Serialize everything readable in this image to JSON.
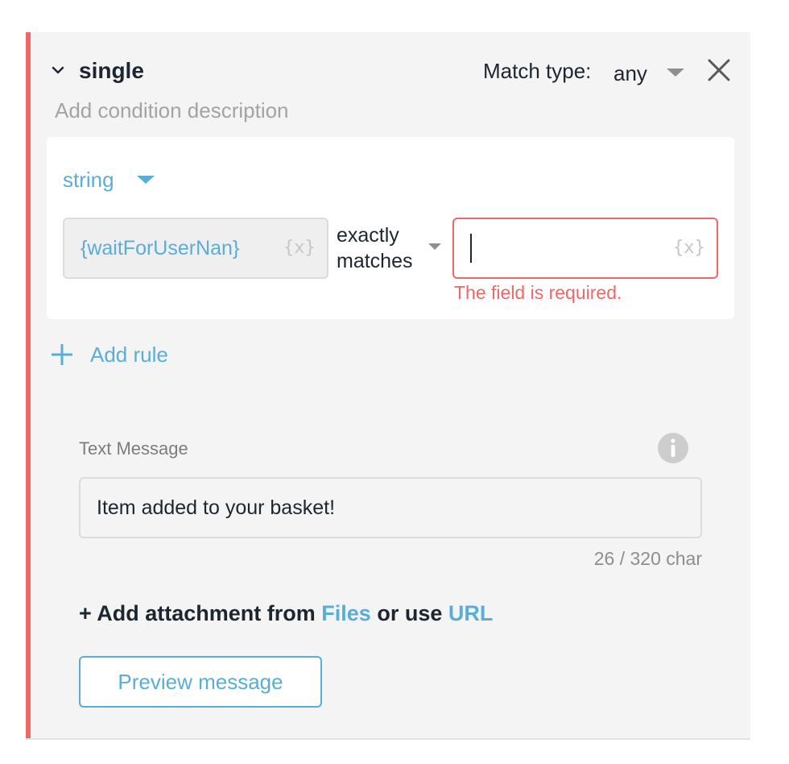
{
  "condition": {
    "name": "single",
    "description_placeholder": "Add condition description",
    "match_type_label": "Match type:",
    "match_type_value": "any"
  },
  "rule": {
    "type_label": "string",
    "variable_value": "{waitForUserNan}",
    "variable_badge": "{x}",
    "operator_line1": "exactly",
    "operator_line2": "matches",
    "value_input": "",
    "value_badge": "{x}",
    "error": "The field is required."
  },
  "add_rule_label": "Add rule",
  "text_message": {
    "label": "Text Message",
    "value": "Item added to your basket!",
    "counter": "26 / 320 char"
  },
  "attachment": {
    "prefix": "+ Add attachment from ",
    "files_link": "Files",
    "middle": " or use ",
    "url_link": "URL"
  },
  "preview_button_label": "Preview message",
  "colors": {
    "accent_error": "#ef6767",
    "link_blue": "#5aaed6",
    "text_dark": "#1d2630",
    "panel_bg": "#f4f4f4"
  },
  "icons": [
    "chevron-down-icon",
    "caret-down-icon",
    "close-icon",
    "plus-icon",
    "info-icon"
  ]
}
